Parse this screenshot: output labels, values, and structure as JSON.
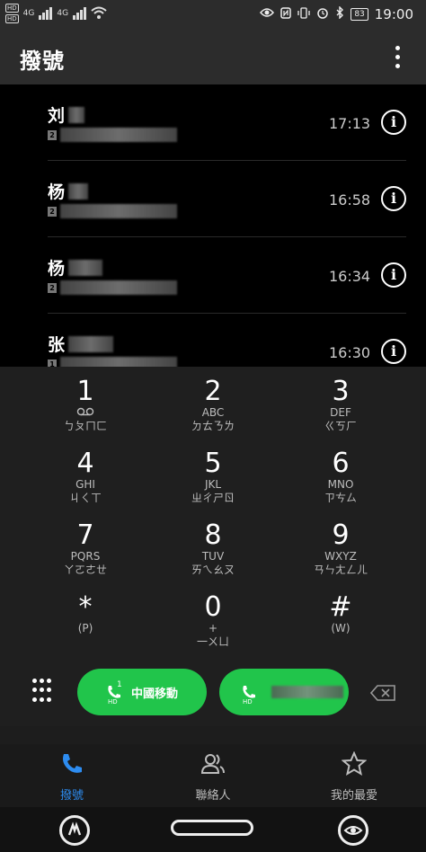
{
  "status": {
    "left_tags": [
      "HD",
      "HD"
    ],
    "net1": "4G",
    "net2": "4G",
    "battery": "83",
    "time": "19:00",
    "icons": [
      "wifi-icon",
      "eye-icon",
      "nfc-icon",
      "vibrate-icon",
      "alarm-icon",
      "bluetooth-icon"
    ]
  },
  "appbar": {
    "title": "撥號"
  },
  "calls": [
    {
      "name": "刘",
      "sim": "2",
      "time": "17:13"
    },
    {
      "name": "杨",
      "sim": "2",
      "hd": "HD",
      "time": "16:58"
    },
    {
      "name": "杨",
      "sim": "2",
      "hd": "HD",
      "time": "16:34"
    },
    {
      "name": "张",
      "sim": "1",
      "hd": "HD",
      "time": "16:30"
    }
  ],
  "keypad": [
    {
      "digit": "1",
      "letters": "",
      "zhuyin": "ㄅㄆㄇㄈ"
    },
    {
      "digit": "2",
      "letters": "ABC",
      "zhuyin": "ㄉㄊㄋㄌ"
    },
    {
      "digit": "3",
      "letters": "DEF",
      "zhuyin": "ㄍㄎㄏ"
    },
    {
      "digit": "4",
      "letters": "GHI",
      "zhuyin": "ㄐㄑㄒ"
    },
    {
      "digit": "5",
      "letters": "JKL",
      "zhuyin": "ㄓㄔㄕㄖ"
    },
    {
      "digit": "6",
      "letters": "MNO",
      "zhuyin": "ㄗㄘㄙ"
    },
    {
      "digit": "7",
      "letters": "PQRS",
      "zhuyin": "ㄚㄛㄜㄝ"
    },
    {
      "digit": "8",
      "letters": "TUV",
      "zhuyin": "ㄞㄟㄠㄡ"
    },
    {
      "digit": "9",
      "letters": "WXYZ",
      "zhuyin": "ㄢㄣㄤㄥㄦ"
    },
    {
      "digit": "*",
      "letters": "(P)",
      "zhuyin": ""
    },
    {
      "digit": "0",
      "letters": "+",
      "zhuyin": "一ㄨㄩ"
    },
    {
      "digit": "#",
      "letters": "(W)",
      "zhuyin": ""
    }
  ],
  "dial": {
    "sim1_label": "中國移動",
    "sim1_badge": "1",
    "sim1_hd": "HD",
    "sim2_label": "",
    "sim2_badge": "2",
    "sim2_hd": "HD",
    "button_color": "#21c54b"
  },
  "tabs": [
    {
      "label": "撥號",
      "icon": "phone-icon",
      "active": true,
      "color": "#2d8cf0"
    },
    {
      "label": "聯絡人",
      "icon": "contacts-icon",
      "active": false
    },
    {
      "label": "我的最愛",
      "icon": "star-icon",
      "active": false
    }
  ]
}
